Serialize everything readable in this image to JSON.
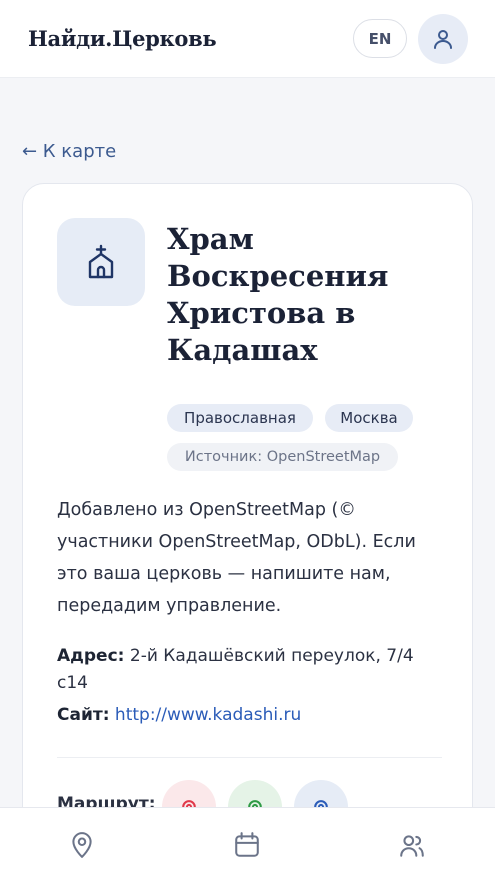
{
  "header": {
    "brand": "Найди.Церковь",
    "lang_button": "EN",
    "profile_icon": "user-icon"
  },
  "back_link": {
    "label": "← К карте"
  },
  "church": {
    "icon": "church-icon",
    "title": "Храм Воскресения Христова в Кадашах",
    "tags": {
      "denomination": "Православная",
      "city": "Москва"
    },
    "source": "Источник: OpenStreetMap",
    "description": "Добавлено из OpenStreetMap (© участники OpenStreetMap, ODbL). Если это ваша церковь — напишите нам, передадим управление.",
    "address_label": "Адрес:",
    "address_value": "2-й Кадашёвский переулок, 7/4 с14",
    "site_label": "Сайт:",
    "site_value": "http://www.kadashi.ru",
    "route_label": "Маршрут:",
    "route_buttons": [
      {
        "icon": "route-pin-icon",
        "color": "#e0394a"
      },
      {
        "icon": "route-pin-icon",
        "color": "#2e9a45"
      },
      {
        "icon": "route-pin-icon",
        "color": "#2b5cb8"
      }
    ]
  },
  "bottom_nav": {
    "items": [
      {
        "icon": "map-pin-icon"
      },
      {
        "icon": "calendar-icon"
      },
      {
        "icon": "people-icon"
      }
    ]
  },
  "colors": {
    "accent": "#3c5a8f",
    "link": "#2b5cb8",
    "chip_bg": "#e7ecf6",
    "page_bg": "#f5f6f9"
  }
}
